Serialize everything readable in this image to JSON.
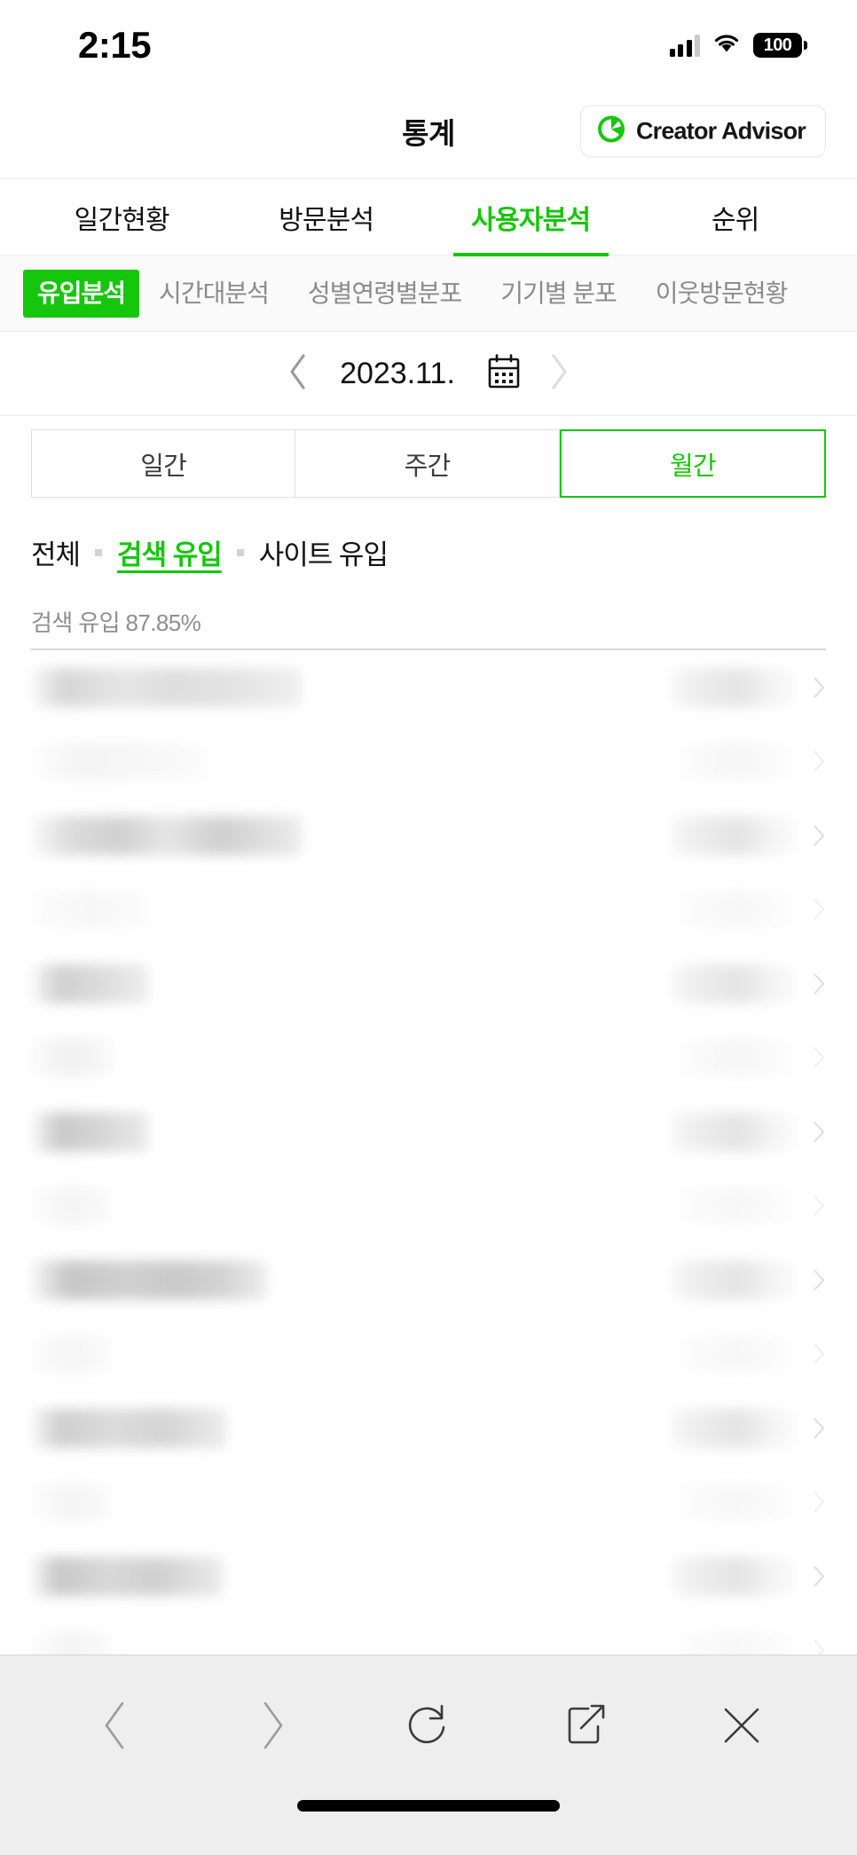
{
  "status_bar": {
    "time": "2:15",
    "battery_percent": "100",
    "signal_icon": "cellular-signal-icon",
    "wifi_icon": "wifi-icon",
    "battery_icon": "battery-full-icon"
  },
  "header": {
    "title": "통계",
    "creator_advisor": {
      "label": "Creator Advisor",
      "logo_icon": "creator-advisor-logo-icon"
    }
  },
  "main_tabs": [
    {
      "label": "일간현황",
      "active": false
    },
    {
      "label": "방문분석",
      "active": false
    },
    {
      "label": "사용자분석",
      "active": true
    },
    {
      "label": "순위",
      "active": false
    }
  ],
  "sub_tabs": [
    {
      "label": "유입분석",
      "active": true
    },
    {
      "label": "시간대분석",
      "active": false
    },
    {
      "label": "성별연령별분포",
      "active": false
    },
    {
      "label": "기기별 분포",
      "active": false
    },
    {
      "label": "이웃방문현황",
      "active": false
    }
  ],
  "date_nav": {
    "prev_icon": "chevron-left-icon",
    "next_icon": "chevron-right-icon",
    "value": "2023.11.",
    "calendar_icon": "calendar-icon"
  },
  "period_segments": [
    {
      "label": "일간",
      "active": false
    },
    {
      "label": "주간",
      "active": false
    },
    {
      "label": "월간",
      "active": true
    }
  ],
  "filters": [
    {
      "label": "전체",
      "active": false
    },
    {
      "label": "검색 유입",
      "active": true
    },
    {
      "label": "사이트 유입",
      "active": false
    }
  ],
  "section": {
    "label": "검색 유입 87.85%"
  },
  "list": {
    "redacted": true,
    "rows": [
      {
        "label_width": 305,
        "value_width": 140
      },
      {
        "label_width": 198,
        "value_width": 130
      },
      {
        "label_width": 305,
        "value_width": 140
      },
      {
        "label_width": 132,
        "value_width": 130
      },
      {
        "label_width": 132,
        "value_width": 140
      },
      {
        "label_width": 92,
        "value_width": 130
      },
      {
        "label_width": 132,
        "value_width": 140
      },
      {
        "label_width": 92,
        "value_width": 130
      },
      {
        "label_width": 266,
        "value_width": 140
      },
      {
        "label_width": 92,
        "value_width": 130
      },
      {
        "label_width": 220,
        "value_width": 140
      },
      {
        "label_width": 92,
        "value_width": 130
      },
      {
        "label_width": 216,
        "value_width": 140
      },
      {
        "label_width": 92,
        "value_width": 130
      },
      {
        "label_width": 250,
        "value_width": 140
      }
    ],
    "row_chevron_icon": "chevron-right-small-icon"
  },
  "browser_toolbar": [
    {
      "name": "back-button",
      "icon": "chevron-left-icon",
      "disabled": true
    },
    {
      "name": "forward-button",
      "icon": "chevron-right-icon",
      "disabled": true
    },
    {
      "name": "reload-button",
      "icon": "reload-icon",
      "disabled": false
    },
    {
      "name": "share-button",
      "icon": "share-icon",
      "disabled": false
    },
    {
      "name": "close-button",
      "icon": "close-icon",
      "disabled": false
    }
  ],
  "colors": {
    "accent_green": "#16c60c",
    "text_primary": "#121212",
    "text_muted": "#8e8e8e",
    "toolbar_bg": "#eeeeee"
  },
  "home_indicator": "home-indicator-bar"
}
